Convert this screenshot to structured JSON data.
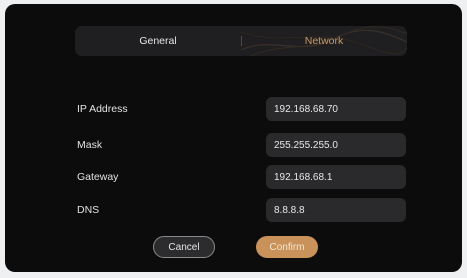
{
  "tabs": {
    "general_label": "General",
    "network_label": "Network",
    "active": "Network"
  },
  "network": {
    "ip_address": {
      "label": "IP Address",
      "value": "192.168.68.70"
    },
    "mask": {
      "label": "Mask",
      "value": "255.255.255.0"
    },
    "gateway": {
      "label": "Gateway",
      "value": "192.168.68.1"
    },
    "dns": {
      "label": "DNS",
      "value": "8.8.8.8"
    }
  },
  "buttons": {
    "cancel_label": "Cancel",
    "confirm_label": "Confirm"
  },
  "colors": {
    "accent": "#c8925a",
    "panel_background": "#0c0c0d",
    "field_background": "#2a2a2c"
  }
}
